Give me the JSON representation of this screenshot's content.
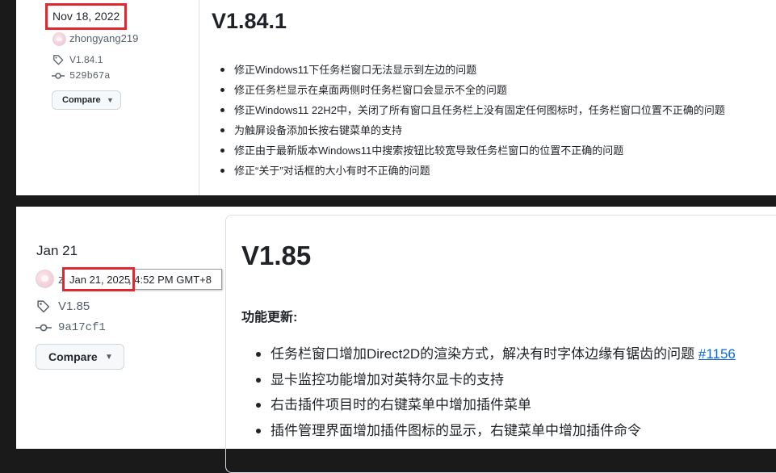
{
  "top_release": {
    "date": "Nov 18, 2022",
    "author": "zhongyang219",
    "tag": "V1.84.1",
    "commit": "529b67a",
    "compare_label": "Compare",
    "title": "V1.84.1",
    "notes": [
      "修正Windows11下任务栏窗口无法显示到左边的问题",
      "修正任务栏显示在桌面两侧时任务栏窗口会显示不全的问题",
      "修正Windows11 22H2中，关闭了所有窗口且任务栏上没有固定任何图标时，任务栏窗口位置不正确的问题",
      "为触屏设备添加长按右键菜单的支持",
      "修正由于最新版本Windows11中搜索按钮比较宽导致任务栏窗口的位置不正确的问题",
      "修正“关于”对话框的大小有时不正确的问题"
    ]
  },
  "bottom_release": {
    "date": "Jan 21",
    "author_initial": "z",
    "tooltip_date": "Jan 21, 2025",
    "tooltip_rest": ", 4:52 PM GMT+8",
    "tag": "V1.85",
    "commit": "9a17cf1",
    "compare_label": "Compare",
    "title": "V1.85",
    "section_heading": "功能更新:",
    "notes": [
      "任务栏窗口增加Direct2D的渲染方式，解决有时字体边缘有锯齿的问题 ",
      "显卡监控功能增加对英特尔显卡的支持",
      "右击插件项目时的右键菜单中增加插件菜单",
      "插件管理界面增加插件图标的显示，右键菜单中增加插件命令"
    ],
    "issue_link": "#1156"
  },
  "highlight_color": "#e0282e"
}
